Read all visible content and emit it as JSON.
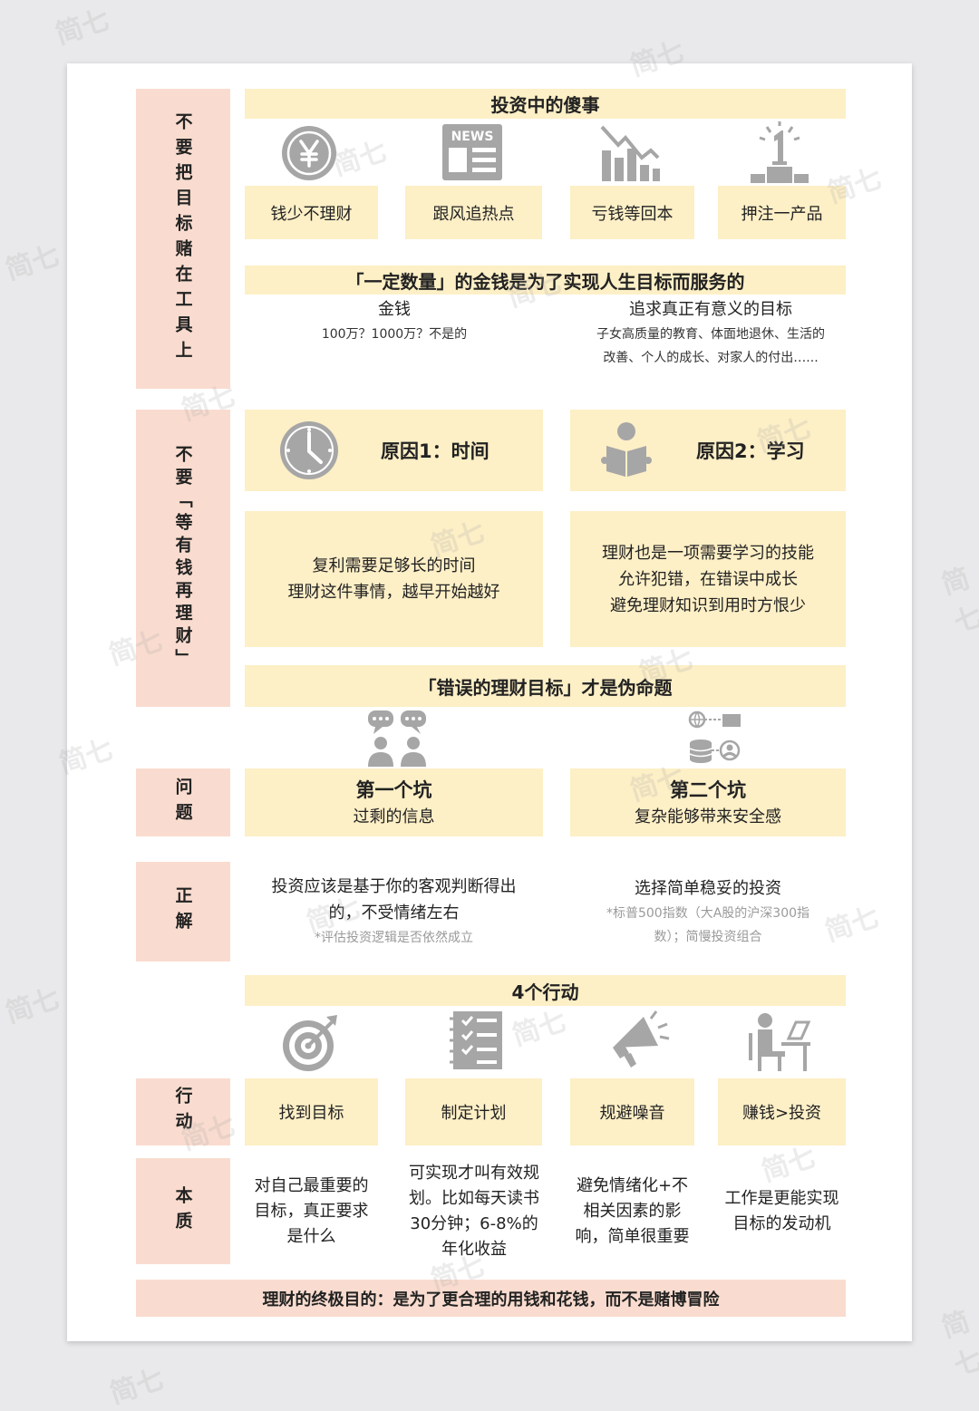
{
  "section1": {
    "label": "不要把目标赌在工具上",
    "bar_title": "投资中的傻事",
    "icons": [
      "yen-coin-icon",
      "news-icon",
      "declining-bar-chart-icon",
      "number-one-podium-icon"
    ],
    "items": [
      "钱少不理财",
      "跟风追热点",
      "亏钱等回本",
      "押注一产品"
    ],
    "purpose_title": "「一定数量」的金钱是为了实现人生目标而服务的",
    "money_heading": "金钱",
    "money_text": "100万？1000万？不是的",
    "goal_heading": "追求真正有意义的目标",
    "goal_text_1": "子女高质量的教育、体面地退休、生活的",
    "goal_text_2": "改善、个人的成长、对家人的付出…..."
  },
  "section2": {
    "label": "不要「等有钱再理财」",
    "reason1_title": "原因1：时间",
    "reason2_title": "原因2：学习",
    "reason1_lines": [
      "复利需要足够长的时间",
      "理财这件事情，越早开始越好"
    ],
    "reason2_lines": [
      "理财也是一项需要学习的技能",
      "允许犯错，在错误中成长",
      "避免理财知识到用时方恨少"
    ]
  },
  "section3": {
    "bar_title": "「错误的理财目标」才是伪命题",
    "problem_label": "问题",
    "pit1_title": "第一个坑",
    "pit1_text": "过剩的信息",
    "pit2_title": "第二个坑",
    "pit2_text": "复杂能够带来安全感",
    "answer_label": "正解",
    "answer1_lines": [
      "投资应该是基于你的客观判断得出",
      "的，不受情绪左右"
    ],
    "answer1_note": "*评估投资逻辑是否依然成立",
    "answer2_main": "选择简单稳妥的投资",
    "answer2_note_lines": [
      "*标普500指数（大A股的沪深300指",
      "数）；简慢投资组合"
    ]
  },
  "section4": {
    "bar_title": "4个行动",
    "action_label": "行动",
    "essence_label": "本质",
    "actions": [
      "找到目标",
      "制定计划",
      "规避噪音",
      "赚钱>投资"
    ],
    "essences": [
      [
        "对自己最重要的",
        "目标，真正要求",
        "是什么"
      ],
      [
        "可实现才叫有效规",
        "划。比如每天读书",
        "30分钟；6-8%的",
        "年化收益"
      ],
      [
        "避免情绪化+不",
        "相关因素的影",
        "响，简单很重要"
      ],
      [
        "工作是更能实现",
        "目标的发动机"
      ]
    ]
  },
  "footer": "理财的终极目的：是为了更合理的用钱和花钱，而不是赌博冒险",
  "watermark": "简七",
  "colors": {
    "pink": "#f9dccf",
    "yellow": "#fdefc6",
    "icon_gray": "#a6a6a6"
  }
}
